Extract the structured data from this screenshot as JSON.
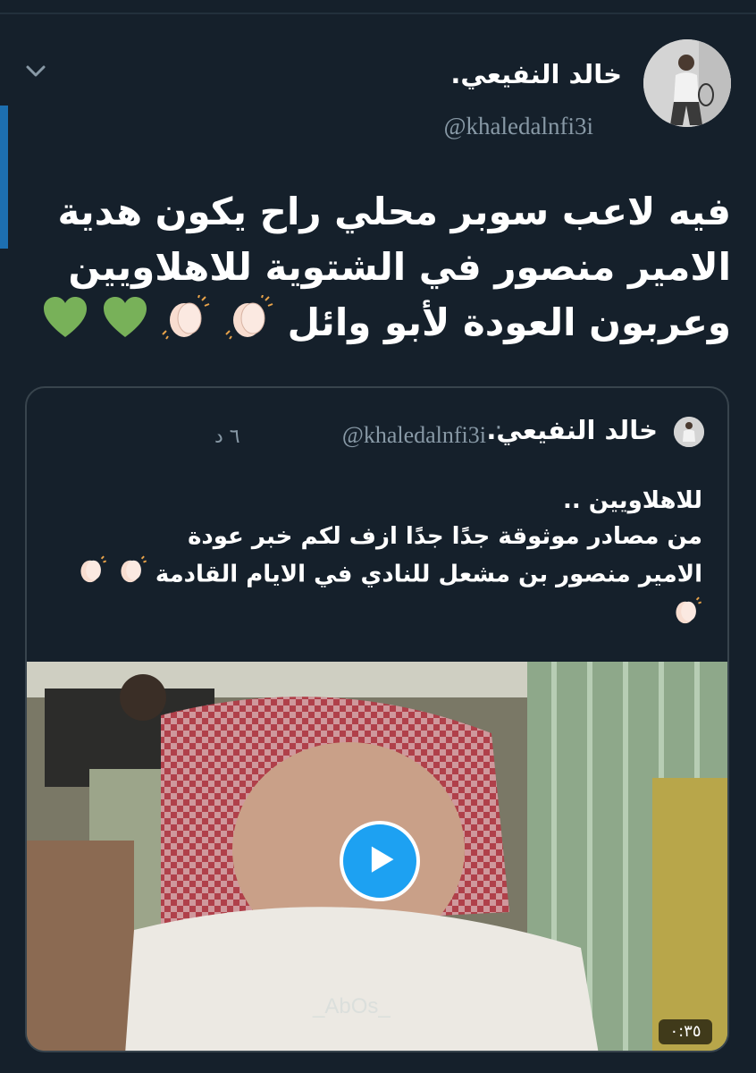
{
  "tweet": {
    "author_name": "خالد النفيعي.",
    "handle": "@khaledalnfi3i",
    "text_lines": [
      "فيه لاعب سوبر محلي راح يكون هدية",
      "الامير منصور في الشتوية للاهلاويين",
      "وعربون العودة لأبو وائل"
    ],
    "icons": [
      "chevron-down-icon",
      "clapping-hands-icon",
      "green-heart-icon"
    ]
  },
  "quote": {
    "author_name": "خالد النفيعي.",
    "handle": "@khaledalnfi3i",
    "separator": "·",
    "time": "٦ د",
    "text_lines": [
      "للاهلاويين ..",
      "من مصادر موثوقة جدًا جدًا ازف لكم خبر عودة",
      "الامير منصور بن مشعل للنادي في الايام القادمة"
    ],
    "video": {
      "duration": "٠:٣٥",
      "watermark": "_AbOs_",
      "icon": "play-icon"
    }
  },
  "colors": {
    "background": "#15202b",
    "accent": "#1da1f2",
    "muted_text": "#8899a6",
    "border": "#38444d"
  }
}
